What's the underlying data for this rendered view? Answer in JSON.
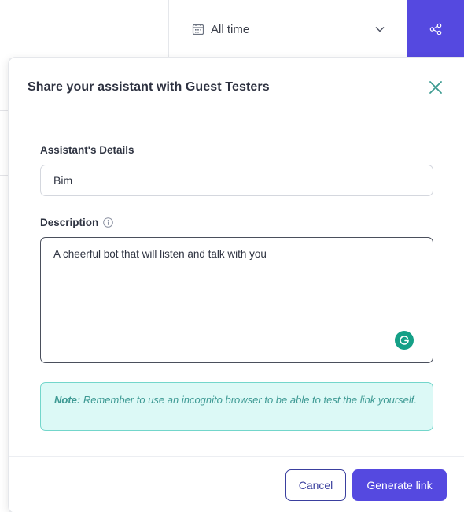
{
  "topbar": {
    "date_filter": {
      "label": "All time",
      "icon": "calendar-icon",
      "dropdown_icon": "chevron-down-icon"
    },
    "share_button": {
      "icon": "share-icon",
      "color": "#5549e0"
    }
  },
  "modal": {
    "title": "Share your assistant with Guest Testers",
    "close_icon": "close-icon",
    "details_label": "Assistant's Details",
    "name_value": "Bim",
    "description_label": "Description",
    "description_info_icon": "info-icon",
    "description_value": "A cheerful bot that will listen and talk with you",
    "note": {
      "prefix": "Note:",
      "text": " Remember to use an incognito browser to be able to test the link yourself."
    },
    "buttons": {
      "cancel": "Cancel",
      "generate": "Generate link"
    }
  },
  "colors": {
    "accent": "#5549e0",
    "close": "#3c9a90",
    "note_bg": "#dcf9f6",
    "note_border": "#73d6cb",
    "note_text": "#3e9a94"
  }
}
